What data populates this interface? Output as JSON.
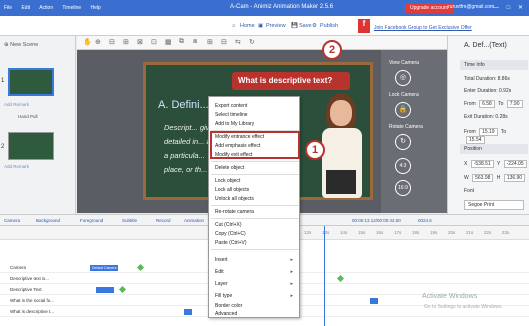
{
  "titlebar": {
    "menu": [
      "File",
      "Edit",
      "Action",
      "Timeline",
      "Help"
    ],
    "title": "A-Cam - Animiz Animation Maker 2.5.6",
    "upgrade": "Upgrade account",
    "email": "ruruvtfm@gmail.com",
    "window_controls": "—  □  ✕"
  },
  "toolbar": {
    "home": "Home",
    "preview": "Preview",
    "save": "Save",
    "publish": "Publish",
    "facebook": "Join Facebook Group to Get Exclusive Offer"
  },
  "left": {
    "new_scene": "New Scene",
    "scenes": [
      {
        "num": "1",
        "label": "Hand Pull",
        "remark": "Add Remark"
      },
      {
        "num": "2",
        "label": "",
        "remark": "Add Remark"
      }
    ]
  },
  "board": {
    "headline": "A. Defini...",
    "lines": [
      "Descript...                                           give a",
      "detailed in...                                         about",
      "a particula...",
      "place, or th..."
    ]
  },
  "callout": "What is descriptive text?",
  "markers": {
    "one": "1",
    "two": "2"
  },
  "context_menu": [
    "Export content",
    "Select timeline",
    "Add to My Library",
    "Modify entrance effect",
    "Add emphasis effect",
    "Modify exit effect",
    "Delete object",
    "Lock object",
    "Lock all objects",
    "Unlock all objects",
    "Re-rotate camera",
    "Cut (Ctrl+X)",
    "Copy (Ctrl+C)",
    "Paste (Ctrl+V)",
    "Insert",
    "Edit",
    "Layer",
    "Fill type",
    "Border color",
    "Advanced"
  ],
  "camera": {
    "view": "View Camera",
    "lock": "Lock Camera",
    "rotate": "Rotate Camera",
    "values": [
      "4:3",
      "16:9"
    ]
  },
  "right_panel": {
    "title": "A. Def...(Text)",
    "time_info": "Time Info",
    "total_duration": "Total Duration: 8.86s",
    "enter_duration": "Enter Duration: 0.92s",
    "from": "6.58",
    "to": "7.90",
    "exit_duration": "Exit Duration: 0.28s",
    "from2": "15.19",
    "to2": "15.54",
    "position": "Position",
    "x": "-538.51",
    "y": "-224.05",
    "w": "563.98",
    "h": "136.90",
    "font": "Font",
    "font_name": "Segoe Print"
  },
  "bottombar": [
    "Camera",
    "Background",
    "Foreground",
    "Subtitle",
    "Record",
    "Animation"
  ],
  "timecode": "00:00:13.12/00:00:42.50",
  "zoom": "0024.6",
  "ruler": [
    "7s",
    "8s",
    "9s",
    "10s",
    "11s",
    "12s",
    "13s",
    "14s",
    "15s",
    "16s",
    "17s",
    "18s",
    "19s",
    "20s",
    "21s",
    "22s",
    "23s"
  ],
  "tracks": [
    "Camera",
    "Descriptive text is...",
    "Descriptive Text",
    "What is the social fu...",
    "What is descriptive t..."
  ],
  "track_label": "Default Camera",
  "watermark": {
    "line1": "Activate Windows",
    "line2": "Go to Settings to activate Windows."
  }
}
